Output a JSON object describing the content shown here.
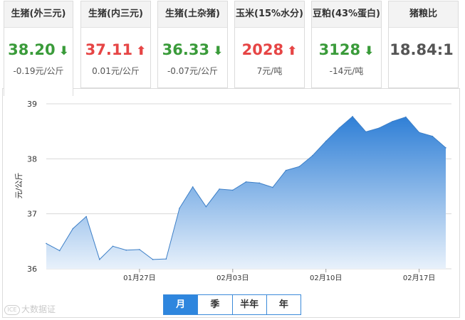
{
  "cards": [
    {
      "title": "生猪(外三元)",
      "value": "38.20",
      "arrow": "⬇",
      "direction": "down",
      "change": "-0.19元/公斤",
      "active": true
    },
    {
      "title": "生猪(内三元)",
      "value": "37.11",
      "arrow": "⬆",
      "direction": "up",
      "change": "0.01元/公斤",
      "active": false
    },
    {
      "title": "生猪(土杂猪)",
      "value": "36.33",
      "arrow": "⬇",
      "direction": "down",
      "change": "-0.07元/公斤",
      "active": false
    },
    {
      "title": "玉米(15%水分)",
      "value": "2028",
      "arrow": "⬆",
      "direction": "up",
      "change": "7元/吨",
      "active": false
    },
    {
      "title": "豆粕(43%蛋白)",
      "value": "3128",
      "arrow": "⬇",
      "direction": "down",
      "change": "-14元/吨",
      "active": false
    },
    {
      "title": "猪粮比",
      "value": "18.84:1",
      "arrow": "",
      "direction": "flat",
      "change": "",
      "active": false
    }
  ],
  "range_tabs": [
    {
      "label": "月",
      "selected": true
    },
    {
      "label": "季",
      "selected": false
    },
    {
      "label": "半年",
      "selected": false
    },
    {
      "label": "年",
      "selected": false
    }
  ],
  "watermark": {
    "logo": "ICE",
    "text": "大数据证"
  },
  "colors": {
    "up": "#e64545",
    "down": "#3a9b3a",
    "accent": "#2e86de",
    "area_top": "#2f7fd6",
    "area_bottom": "#e8f1fb"
  },
  "chart_data": {
    "type": "area",
    "ylabel": "元/公斤",
    "ylim": [
      36,
      39
    ],
    "yticks": [
      36,
      37,
      38,
      39
    ],
    "x_start": "01月20日",
    "xticks": [
      {
        "index": 7,
        "label": "01月27日"
      },
      {
        "index": 14,
        "label": "02月03日"
      },
      {
        "index": 21,
        "label": "02月10日"
      },
      {
        "index": 28,
        "label": "02月17日"
      }
    ],
    "grid": true,
    "values": [
      36.46,
      36.33,
      36.73,
      36.95,
      36.17,
      36.41,
      36.34,
      36.35,
      36.17,
      36.18,
      37.1,
      37.49,
      37.13,
      37.45,
      37.43,
      37.58,
      37.56,
      37.48,
      37.79,
      37.86,
      38.06,
      38.32,
      38.56,
      38.77,
      38.49,
      38.56,
      38.68,
      38.76,
      38.48,
      38.41,
      38.2
    ]
  }
}
